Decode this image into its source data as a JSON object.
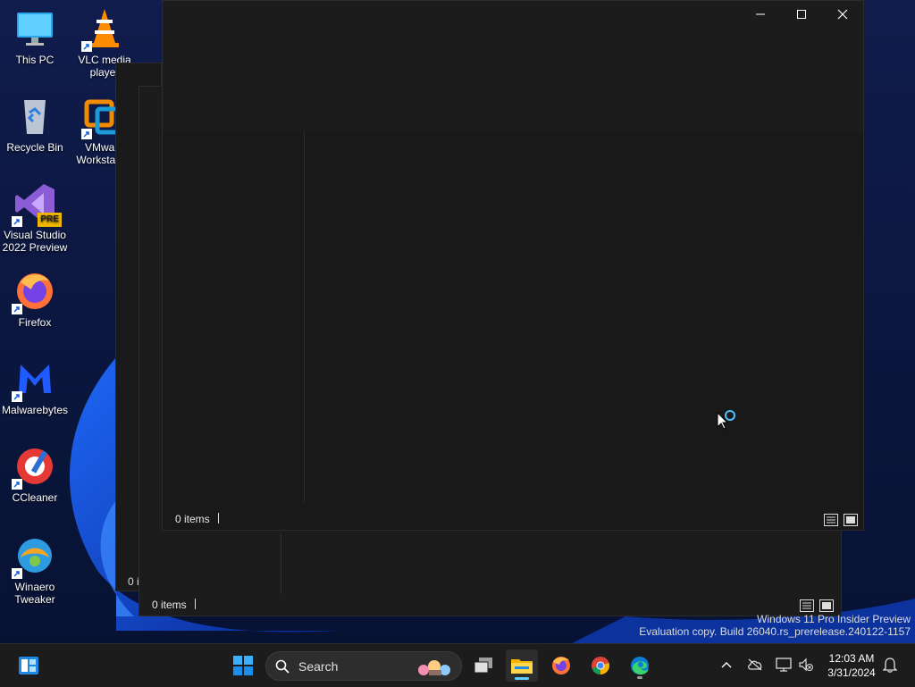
{
  "desktop": {
    "icons": [
      {
        "label": "This PC",
        "icon": "computer-icon"
      },
      {
        "label": "VLC media player",
        "icon": "vlc-cone-icon"
      },
      {
        "label": "Recycle Bin",
        "icon": "recycle-bin-icon"
      },
      {
        "label": "VMware Workstation",
        "icon": "vmware-icon"
      },
      {
        "label": "Visual Studio 2022 Preview",
        "icon": "visual-studio-icon",
        "badge": "PRE"
      },
      {
        "label": "Firefox",
        "icon": "firefox-icon"
      },
      {
        "label": "Malwarebytes",
        "icon": "malwarebytes-icon"
      },
      {
        "label": "CCleaner",
        "icon": "ccleaner-icon"
      },
      {
        "label": "Winaero Tweaker",
        "icon": "winaero-tweaker-icon"
      }
    ]
  },
  "windows": {
    "front": {
      "status_items": "0 items"
    },
    "back": {
      "status_items": "0 items",
      "partial_status": "0 i"
    }
  },
  "watermark": {
    "line1": "Windows 11 Pro Insider Preview",
    "line2": "Evaluation copy. Build 26040.rs_prerelease.240122-1157"
  },
  "taskbar": {
    "search_placeholder": "Search",
    "clock_time": "12:03 AM",
    "clock_date": "3/31/2024"
  },
  "colors": {
    "accent": "#60cdff",
    "taskbar_bg": "#1c1c1c",
    "window_bg": "#191919"
  }
}
